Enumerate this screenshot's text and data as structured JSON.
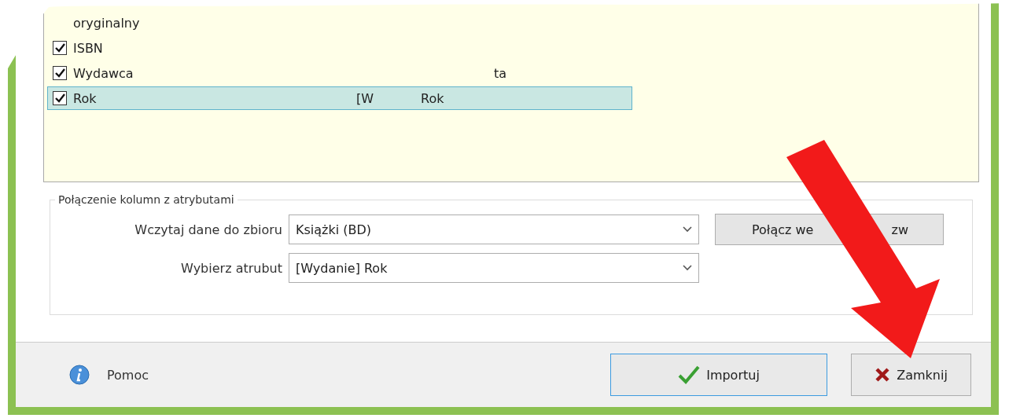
{
  "attribute_list": {
    "rows": [
      {
        "name_parts": [
          "oryginalny"
        ],
        "value_parts": [],
        "checked": null,
        "selected": false
      },
      {
        "name_parts": [
          "ISBN"
        ],
        "value_parts": [],
        "checked": true,
        "selected": false
      },
      {
        "name_parts": [
          "Wydawca"
        ],
        "value_parts": [
          "ta"
        ],
        "checked": true,
        "selected": false
      },
      {
        "name_parts": [
          "Rok"
        ],
        "value_parts": [
          "[W",
          "Rok"
        ],
        "checked": true,
        "selected": true
      }
    ]
  },
  "mapping_group": {
    "legend": "Połączenie kolumn z atrybutami",
    "fields": [
      {
        "label": "Wczytaj dane do zbioru",
        "value": "Książki (BD)"
      },
      {
        "label": "Wybierz atrubut",
        "value": "[Wydanie] Rok"
      }
    ],
    "match_button_parts": [
      "Połącz we",
      "zw"
    ]
  },
  "footer": {
    "help": "Pomoc",
    "buttons": [
      {
        "kind": "import",
        "label": "Importuj",
        "focused": true
      },
      {
        "kind": "close",
        "label": "Zamknij",
        "focused": false
      }
    ]
  }
}
